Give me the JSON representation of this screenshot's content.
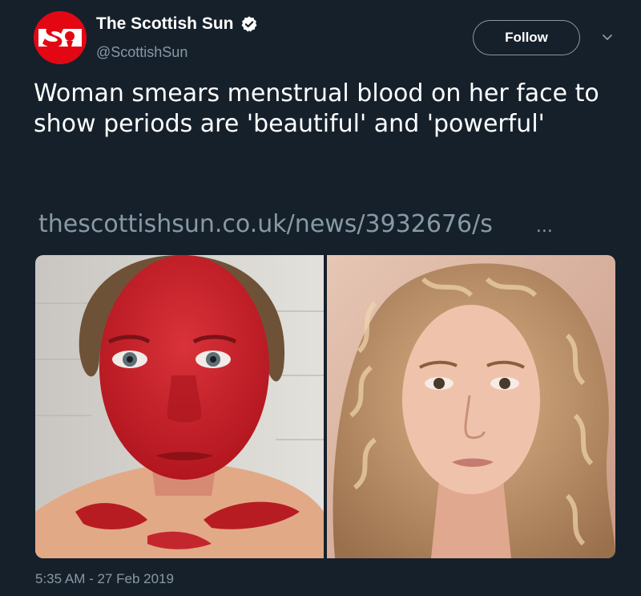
{
  "account": {
    "display_name": "The Scottish Sun",
    "handle": "@ScottishSun",
    "avatar_icon": "scottish-sun-logo",
    "verified_icon": "verified-badge-icon",
    "brand_color": "#e30613"
  },
  "actions": {
    "follow_label": "Follow",
    "menu_icon": "chevron-down-icon"
  },
  "tweet": {
    "text": "Woman smears menstrual blood on her face to show periods are 'beautiful' and 'powerful'",
    "link_text": "thescottishsun.co.uk/news/3932676/s",
    "link_ellipsis": "...",
    "timestamp": "5:35 AM - 27 Feb 2019"
  },
  "media": {
    "photos": [
      {
        "subject": "woman with red smeared face selfie"
      },
      {
        "subject": "woman with curly blonde hair selfie"
      }
    ]
  },
  "theme": {
    "background": "#15202b",
    "text": "#ffffff",
    "secondary_text": "#8899a6"
  }
}
